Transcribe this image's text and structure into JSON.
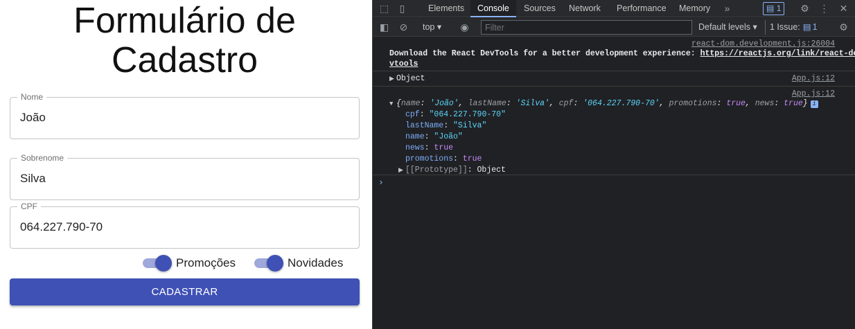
{
  "form": {
    "title": "Formulário de Cadastro",
    "fields": [
      {
        "label": "Nome",
        "value": "João"
      },
      {
        "label": "Sobrenome",
        "value": "Silva"
      },
      {
        "label": "CPF",
        "value": "064.227.790-70"
      }
    ],
    "switches": [
      {
        "label": "Promoções",
        "checked": true
      },
      {
        "label": "Novidades",
        "checked": true
      }
    ],
    "submit_label": "CADASTRAR",
    "accent_color": "#3f51b5"
  },
  "devtools": {
    "tabs": [
      "Elements",
      "Console",
      "Sources",
      "Network",
      "Performance",
      "Memory"
    ],
    "active_tab": "Console",
    "more_tabs_icon": "chevron-double-right-icon",
    "messages_badge": "1",
    "context": "top",
    "filter_placeholder": "Filter",
    "levels": "Default levels",
    "issues_label": "1 Issue:",
    "issues_count": "1",
    "console": {
      "msg1_source": "react-dom.development.js:26004",
      "msg1_text_line1": "Download the React DevTools for a better development experience: ",
      "msg1_link_line1": "https://reactjs.org/link/react-de",
      "msg1_link_line2": "vtools",
      "msg2_source": "App.js:12",
      "msg2_text": "Object",
      "msg3_source": "App.js:12",
      "preview_open": "{",
      "preview_name_key": "name",
      "preview_name_val": "'João'",
      "preview_lastname_key": "lastName",
      "preview_lastname_val": "'Silva'",
      "preview_cpf_key": "cpf",
      "preview_cpf_val": "'064.227.790-70'",
      "preview_promotions_key": "promotions",
      "preview_promotions_val": "true",
      "preview_news_key": "news",
      "preview_news_val": "true",
      "preview_close": "}",
      "props": [
        {
          "key": "cpf",
          "value": "\"064.227.790-70\"",
          "kind": "string"
        },
        {
          "key": "lastName",
          "value": "\"Silva\"",
          "kind": "string"
        },
        {
          "key": "name",
          "value": "\"João\"",
          "kind": "string"
        },
        {
          "key": "news",
          "value": "true",
          "kind": "bool"
        },
        {
          "key": "promotions",
          "value": "true",
          "kind": "bool"
        }
      ],
      "prototype_key": "[[Prototype]]",
      "prototype_val": "Object",
      "prompt_symbol": "›"
    }
  }
}
